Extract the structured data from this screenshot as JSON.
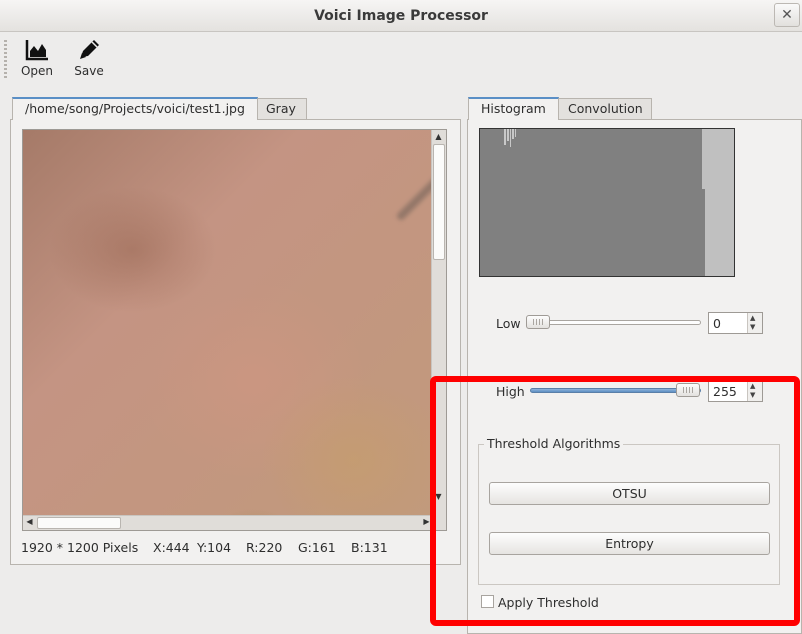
{
  "window": {
    "title": "Voici Image Processor",
    "close_icon": "close-icon"
  },
  "toolbar": {
    "open_label": "Open",
    "open_icon": "area-chart-icon",
    "save_label": "Save",
    "save_icon": "pencil-icon"
  },
  "left_tabs": [
    "/home/song/Projects/voici/test1.jpg",
    "Gray"
  ],
  "status": {
    "dimensions": "1920 * 1200 Pixels",
    "x": "X:444",
    "y": "Y:104",
    "r": "R:220",
    "g": "G:161",
    "b": "B:131"
  },
  "right_tabs": [
    "Histogram",
    "Convolution"
  ],
  "low": {
    "label": "Low",
    "value": "0",
    "slider_fraction": 0.0
  },
  "high": {
    "label": "High",
    "value": "255",
    "slider_fraction": 1.0
  },
  "threshold": {
    "group_title": "Threshold Algorithms",
    "otsu_label": "OTSU",
    "entropy_label": "Entropy",
    "apply_label": "Apply Threshold",
    "apply_checked": false
  },
  "colors": {
    "accent": "#5a8fc6",
    "highlight": "#ff0000",
    "histogram_bg": "#808080"
  }
}
